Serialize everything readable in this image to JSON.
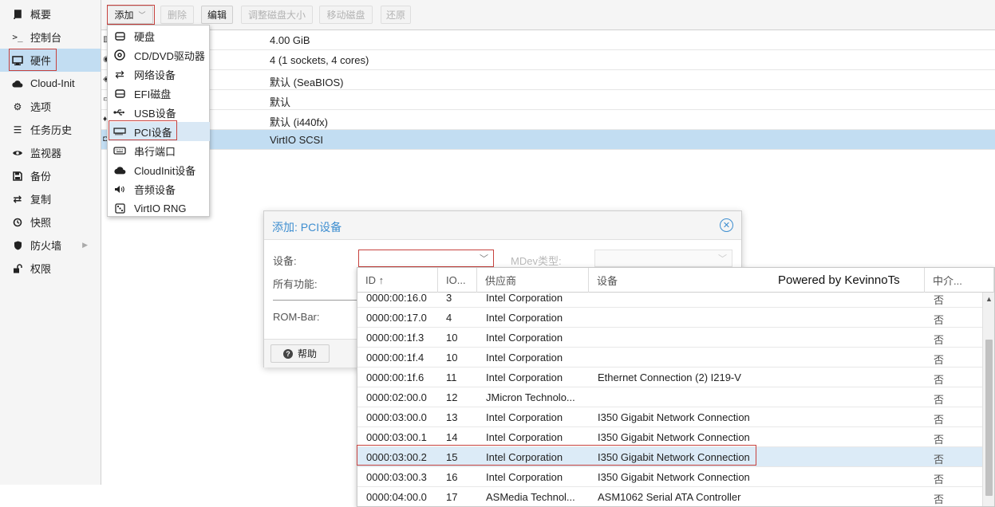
{
  "sidebar": {
    "items": [
      {
        "label": "概要",
        "icon": "book-icon"
      },
      {
        "label": "控制台",
        "icon": "terminal-icon"
      },
      {
        "label": "硬件",
        "icon": "monitor-icon",
        "active": true
      },
      {
        "label": "Cloud-Init",
        "icon": "cloud-icon"
      },
      {
        "label": "选项",
        "icon": "gear-icon"
      },
      {
        "label": "任务历史",
        "icon": "list-icon"
      },
      {
        "label": "监视器",
        "icon": "eye-icon"
      },
      {
        "label": "备份",
        "icon": "floppy-icon"
      },
      {
        "label": "复制",
        "icon": "retweet-icon"
      },
      {
        "label": "快照",
        "icon": "history-icon"
      },
      {
        "label": "防火墙",
        "icon": "shield-icon",
        "has_submenu": true
      },
      {
        "label": "权限",
        "icon": "unlock-icon"
      }
    ]
  },
  "toolbar": {
    "add_label": "添加",
    "remove_label": "删除",
    "edit_label": "编辑",
    "resize_label": "调整磁盘大小",
    "move_label": "移动磁盘",
    "revert_label": "还原"
  },
  "hardware_grid": {
    "rows": [
      {
        "value": "4.00 GiB"
      },
      {
        "value": "4 (1 sockets, 4 cores)"
      },
      {
        "value": "默认 (SeaBIOS)"
      },
      {
        "value": "默认"
      },
      {
        "value": "默认 (i440fx)"
      },
      {
        "value": "VirtIO SCSI",
        "selected": true
      }
    ]
  },
  "add_menu": {
    "items": [
      {
        "label": "硬盘",
        "icon": "hdd-icon"
      },
      {
        "label": "CD/DVD驱动器",
        "icon": "cdrom-icon"
      },
      {
        "label": "网络设备",
        "icon": "exchange-icon"
      },
      {
        "label": "EFI磁盘",
        "icon": "hdd-icon"
      },
      {
        "label": "USB设备",
        "icon": "usb-icon"
      },
      {
        "label": "PCI设备",
        "icon": "pci-card-icon",
        "active": true
      },
      {
        "label": "串行端口",
        "icon": "keyboard-icon"
      },
      {
        "label": "CloudInit设备",
        "icon": "cloud-icon"
      },
      {
        "label": "音频设备",
        "icon": "volume-icon"
      },
      {
        "label": "VirtIO RNG",
        "icon": "dice-icon"
      }
    ]
  },
  "dialog": {
    "title": "添加: PCI设备",
    "device_label": "设备:",
    "device_value": "",
    "mdev_label": "MDev类型:",
    "all_functions_label": "所有功能:",
    "rombar_label": "ROM-Bar:",
    "help_label": "帮助"
  },
  "pci_picker": {
    "columns": {
      "id": "ID ↑",
      "iommu": "IO...",
      "vendor": "供应商",
      "device": "设备",
      "mediated": "中介..."
    },
    "watermark": "Powered by KevinnoTs",
    "rows": [
      {
        "id": "0000:00:16.0",
        "iommu": "3",
        "vendor": "Intel Corporation",
        "device": "",
        "mediated": "否"
      },
      {
        "id": "0000:00:17.0",
        "iommu": "4",
        "vendor": "Intel Corporation",
        "device": "",
        "mediated": "否"
      },
      {
        "id": "0000:00:1f.3",
        "iommu": "10",
        "vendor": "Intel Corporation",
        "device": "",
        "mediated": "否"
      },
      {
        "id": "0000:00:1f.4",
        "iommu": "10",
        "vendor": "Intel Corporation",
        "device": "",
        "mediated": "否"
      },
      {
        "id": "0000:00:1f.6",
        "iommu": "11",
        "vendor": "Intel Corporation",
        "device": "Ethernet Connection (2) I219-V",
        "mediated": "否"
      },
      {
        "id": "0000:02:00.0",
        "iommu": "12",
        "vendor": "JMicron Technolo...",
        "device": "",
        "mediated": "否"
      },
      {
        "id": "0000:03:00.0",
        "iommu": "13",
        "vendor": "Intel Corporation",
        "device": "I350 Gigabit Network Connection",
        "mediated": "否"
      },
      {
        "id": "0000:03:00.1",
        "iommu": "14",
        "vendor": "Intel Corporation",
        "device": "I350 Gigabit Network Connection",
        "mediated": "否"
      },
      {
        "id": "0000:03:00.2",
        "iommu": "15",
        "vendor": "Intel Corporation",
        "device": "I350 Gigabit Network Connection",
        "mediated": "否",
        "selected": true
      },
      {
        "id": "0000:03:00.3",
        "iommu": "16",
        "vendor": "Intel Corporation",
        "device": "I350 Gigabit Network Connection",
        "mediated": "否"
      },
      {
        "id": "0000:04:00.0",
        "iommu": "17",
        "vendor": "ASMedia Technol...",
        "device": "ASM1062 Serial ATA Controller",
        "mediated": "否"
      }
    ]
  },
  "colors": {
    "accent": "#3e8ed0",
    "selection": "#c2ddf2",
    "highlight_box": "#c7423e"
  }
}
